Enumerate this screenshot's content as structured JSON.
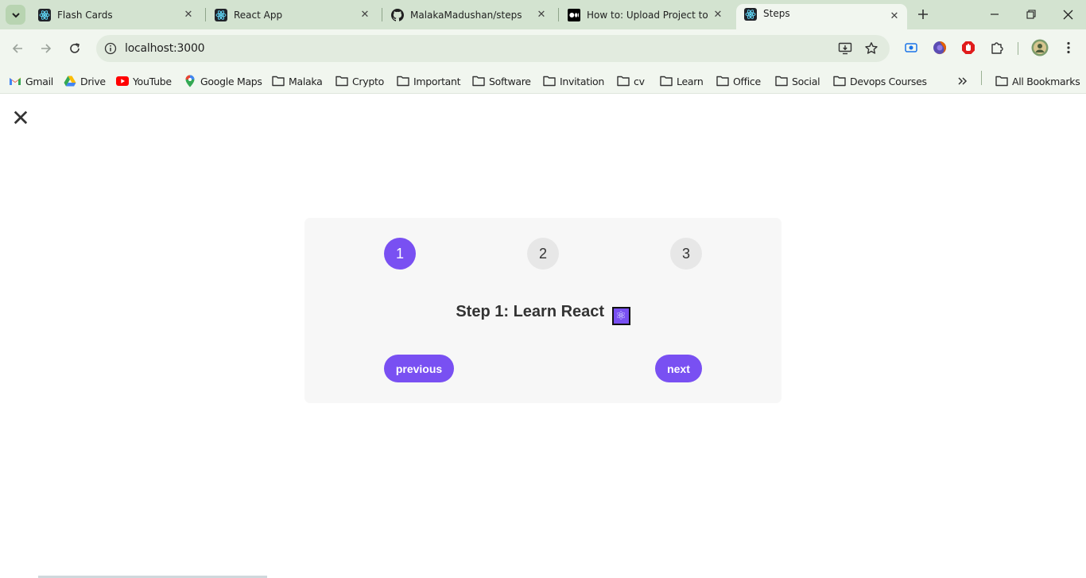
{
  "colors": {
    "accent": "#7950f2",
    "tab_strip_bg": "#d3e3d0",
    "toolbar_bg": "#f1f6ef",
    "card_bg": "#f7f7f7"
  },
  "tabs": [
    {
      "title": "Flash Cards",
      "icon": "react-icon",
      "active": false
    },
    {
      "title": "React App",
      "icon": "react-icon",
      "active": false
    },
    {
      "title": "MalakaMadushan/steps",
      "icon": "github-icon",
      "active": false
    },
    {
      "title": "How to: Upload Project to G",
      "icon": "medium-icon",
      "active": false
    },
    {
      "title": "Steps",
      "icon": "react-icon",
      "active": true
    }
  ],
  "address_bar": {
    "url": "localhost:3000"
  },
  "bookmarks": [
    {
      "label": "Gmail",
      "icon": "gmail-icon"
    },
    {
      "label": "Drive",
      "icon": "drive-icon"
    },
    {
      "label": "YouTube",
      "icon": "youtube-icon"
    },
    {
      "label": "Google Maps",
      "icon": "maps-icon"
    },
    {
      "label": "Malaka",
      "icon": "folder-icon"
    },
    {
      "label": "Crypto",
      "icon": "folder-icon"
    },
    {
      "label": "Important",
      "icon": "folder-icon"
    },
    {
      "label": "Software",
      "icon": "folder-icon"
    },
    {
      "label": "Invitation",
      "icon": "folder-icon"
    },
    {
      "label": "cv",
      "icon": "folder-icon"
    },
    {
      "label": "Learn",
      "icon": "folder-icon"
    },
    {
      "label": "Office",
      "icon": "folder-icon"
    },
    {
      "label": "Social",
      "icon": "folder-icon"
    },
    {
      "label": "Devops Courses",
      "icon": "folder-icon"
    }
  ],
  "all_bookmarks_label": "All Bookmarks",
  "app": {
    "close_symbol": "✕",
    "steps": [
      "1",
      "2",
      "3"
    ],
    "active_step": 1,
    "message": "Step 1: Learn React",
    "message_emoji": "⚛",
    "previous_label": "previous",
    "next_label": "next"
  }
}
